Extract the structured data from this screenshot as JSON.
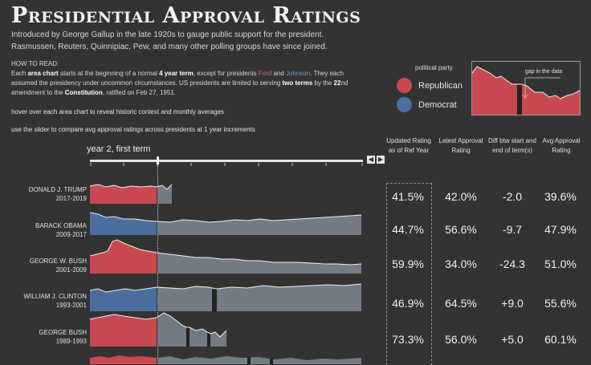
{
  "header": {
    "title": "Presidential Approval Ratings",
    "intro_line1": "Introduced by George Gallup in the late 1920s to gauge public support for the president.",
    "intro_line2": "Rasmussen, Reuters, Quinnipiac, Pew, and many other polling groups have since joined."
  },
  "how_to": {
    "heading": "HOW TO READ:",
    "d1": "Each ",
    "d2": "area chart",
    "d3": " starts at  the beginning of a normal ",
    "d4": "4 year term",
    "d5": ", except for presidents ",
    "d6": "Ford",
    "d7": " and ",
    "d8": "Johnson",
    "d9": ". They each assumed the presidency under uncommon circumstances. US presidents are limited to serving ",
    "d10": "two terms",
    "d11": " by the ",
    "d12": "22",
    "d13": "nd amendment to the ",
    "d14": "Constitution",
    "d15": ", ratified on Feb 27, 1951.",
    "hover_note": "hover over each area chart to reveal historic context and monthly averages",
    "slider_note": "use the slider to compare avg approval ratings across presidents at 1 year increments"
  },
  "legend": {
    "title": "political party",
    "republican": "Republican",
    "democrat": "Democrat",
    "gap_label": "gap in the data",
    "colors": {
      "republican": "#c8494f",
      "democrat": "#4a6f9e",
      "grey": "#737b85"
    }
  },
  "slider": {
    "label": "year 2, first term",
    "prev_icon": "chevron-left-icon",
    "next_icon": "chevron-right-icon",
    "position_fraction": 0.245
  },
  "columns": {
    "c1": "Updated Rating as of Ref Year",
    "c2": "Latest Approval Rating",
    "c3": "Diff btw start and end of term(s)",
    "c4": "Avg Approval Rating"
  },
  "presidents": [
    {
      "name": "DONALD J. TRUMP",
      "years": "2017-2019",
      "party": "republican",
      "ref": "41.5%",
      "latest": "42.0%",
      "diff": "-2.0",
      "avg": "39.6%"
    },
    {
      "name": "BARACK OBAMA",
      "years": "2009-2017",
      "party": "democrat",
      "ref": "44.7%",
      "latest": "56.6%",
      "diff": "-9.7",
      "avg": "47.9%"
    },
    {
      "name": "GEORGE W. BUSH",
      "years": "2001-2009",
      "party": "republican",
      "ref": "59.9%",
      "latest": "34.0%",
      "diff": "-24.3",
      "avg": "51.0%"
    },
    {
      "name": "WILLIAM J. CLINTON",
      "years": "1993-2001",
      "party": "democrat",
      "ref": "46.9%",
      "latest": "64.5%",
      "diff": "+9.0",
      "avg": "55.6%"
    },
    {
      "name": "GEORGE BUSH",
      "years": "1989-1993",
      "party": "republican",
      "ref": "73.3%",
      "latest": "56.0%",
      "diff": "+5.0",
      "avg": "60.1%"
    }
  ]
}
